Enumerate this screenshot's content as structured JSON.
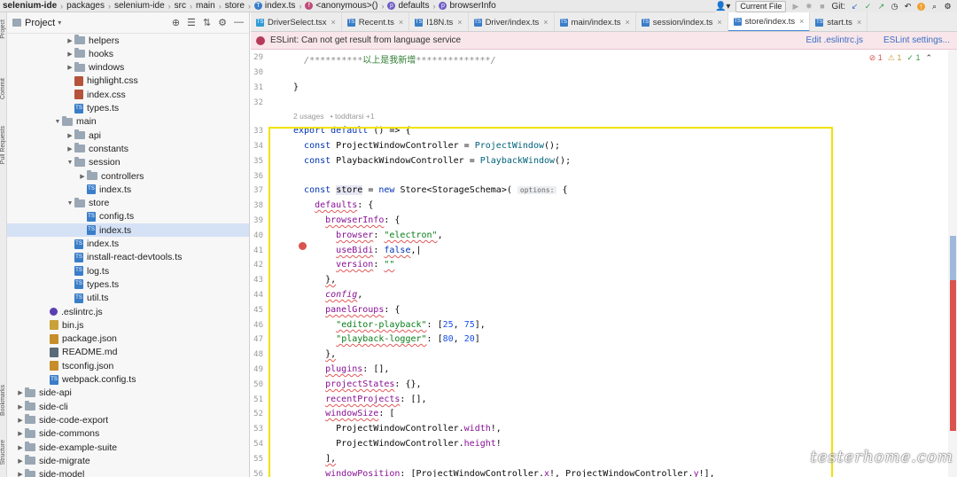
{
  "breadcrumbs": [
    {
      "label": "selenium-ide",
      "icon": "",
      "bold": true
    },
    {
      "label": "packages",
      "icon": ""
    },
    {
      "label": "selenium-ide",
      "icon": ""
    },
    {
      "label": "src",
      "icon": ""
    },
    {
      "label": "main",
      "icon": ""
    },
    {
      "label": "store",
      "icon": ""
    },
    {
      "label": "index.ts",
      "icon": "ts-file-icon"
    },
    {
      "label": "<anonymous>()",
      "icon": "function-icon"
    },
    {
      "label": "defaults",
      "icon": "property-icon"
    },
    {
      "label": "browserInfo",
      "icon": "property-icon"
    }
  ],
  "toolbar": {
    "run_config": "Current File",
    "git_label": "Git:"
  },
  "side_stripe": {
    "project": "Project",
    "commit": "Commit",
    "pull_requests": "Pull Requests",
    "bookmarks": "Bookmarks",
    "structure": "Structure"
  },
  "project_panel": {
    "title": "Project"
  },
  "tree": [
    {
      "label": "helpers",
      "type": "folder",
      "depth": 5,
      "arrow": "▶"
    },
    {
      "label": "hooks",
      "type": "folder",
      "depth": 5,
      "arrow": "▶"
    },
    {
      "label": "windows",
      "type": "folder",
      "depth": 5,
      "arrow": "▶"
    },
    {
      "label": "highlight.css",
      "type": "css",
      "depth": 5,
      "arrow": ""
    },
    {
      "label": "index.css",
      "type": "css",
      "depth": 5,
      "arrow": ""
    },
    {
      "label": "types.ts",
      "type": "ts",
      "depth": 5,
      "arrow": ""
    },
    {
      "label": "main",
      "type": "folder",
      "depth": 4,
      "arrow": "▼"
    },
    {
      "label": "api",
      "type": "folder",
      "depth": 5,
      "arrow": "▶"
    },
    {
      "label": "constants",
      "type": "folder",
      "depth": 5,
      "arrow": "▶"
    },
    {
      "label": "session",
      "type": "folder",
      "depth": 5,
      "arrow": "▼"
    },
    {
      "label": "controllers",
      "type": "folder",
      "depth": 6,
      "arrow": "▶"
    },
    {
      "label": "index.ts",
      "type": "ts",
      "depth": 6,
      "arrow": ""
    },
    {
      "label": "store",
      "type": "folder",
      "depth": 5,
      "arrow": "▼"
    },
    {
      "label": "config.ts",
      "type": "ts",
      "depth": 6,
      "arrow": ""
    },
    {
      "label": "index.ts",
      "type": "ts",
      "depth": 6,
      "arrow": "",
      "selected": true
    },
    {
      "label": "index.ts",
      "type": "ts",
      "depth": 5,
      "arrow": ""
    },
    {
      "label": "install-react-devtools.ts",
      "type": "ts",
      "depth": 5,
      "arrow": ""
    },
    {
      "label": "log.ts",
      "type": "ts",
      "depth": 5,
      "arrow": ""
    },
    {
      "label": "types.ts",
      "type": "ts",
      "depth": 5,
      "arrow": ""
    },
    {
      "label": "util.ts",
      "type": "ts",
      "depth": 5,
      "arrow": ""
    },
    {
      "label": ".eslintrc.js",
      "type": "es",
      "depth": 3,
      "arrow": ""
    },
    {
      "label": "bin.js",
      "type": "js",
      "depth": 3,
      "arrow": ""
    },
    {
      "label": "package.json",
      "type": "json",
      "depth": 3,
      "arrow": ""
    },
    {
      "label": "README.md",
      "type": "md",
      "depth": 3,
      "arrow": ""
    },
    {
      "label": "tsconfig.json",
      "type": "json",
      "depth": 3,
      "arrow": ""
    },
    {
      "label": "webpack.config.ts",
      "type": "ts",
      "depth": 3,
      "arrow": ""
    },
    {
      "label": "side-api",
      "type": "folder",
      "depth": 1,
      "arrow": "▶"
    },
    {
      "label": "side-cli",
      "type": "folder",
      "depth": 1,
      "arrow": "▶"
    },
    {
      "label": "side-code-export",
      "type": "folder",
      "depth": 1,
      "arrow": "▶"
    },
    {
      "label": "side-commons",
      "type": "folder",
      "depth": 1,
      "arrow": "▶"
    },
    {
      "label": "side-example-suite",
      "type": "folder",
      "depth": 1,
      "arrow": "▶"
    },
    {
      "label": "side-migrate",
      "type": "folder",
      "depth": 1,
      "arrow": "▶"
    },
    {
      "label": "side-model",
      "type": "folder",
      "depth": 1,
      "arrow": "▶"
    }
  ],
  "tabs": [
    {
      "label": "DriverSelect.tsx",
      "icon": "tsx"
    },
    {
      "label": "Recent.ts",
      "icon": "ts"
    },
    {
      "label": "I18N.ts",
      "icon": "ts"
    },
    {
      "label": "Driver/index.ts",
      "icon": "ts"
    },
    {
      "label": "main/index.ts",
      "icon": "ts"
    },
    {
      "label": "session/index.ts",
      "icon": "ts"
    },
    {
      "label": "store/index.ts",
      "icon": "ts",
      "active": true
    },
    {
      "label": "start.ts",
      "icon": "ts"
    }
  ],
  "eslint_banner": {
    "message": "ESLint: Can not get result from language service",
    "edit_link": "Edit .eslintrc.js",
    "settings_link": "ESLint settings..."
  },
  "inspections": {
    "errors": "1",
    "warnings": "1",
    "ok": "1"
  },
  "code_meta": {
    "usages": "2 usages",
    "author": "toddtarsi +1"
  },
  "code_lines": [
    {
      "n": "29",
      "html": "  <span class=\"cm\">/**********</span><span class=\"cmg\">以上是我新增</span><span class=\"cm\">**************/</span>"
    },
    {
      "n": "30",
      "html": ""
    },
    {
      "n": "31",
      "html": "}"
    },
    {
      "n": "32",
      "html": ""
    },
    {
      "n": "33",
      "html": "<span class=\"kw\">export default</span> () => {"
    },
    {
      "n": "34",
      "html": "  <span class=\"kw\">const</span> ProjectWindowController = <span class=\"fn\">ProjectWindow</span>();"
    },
    {
      "n": "35",
      "html": "  <span class=\"kw\">const</span> PlaybackWindowController = <span class=\"fn\">PlaybackWindow</span>();"
    },
    {
      "n": "36",
      "html": ""
    },
    {
      "n": "37",
      "html": "  <span class=\"kw\">const</span> <span class=\"hlvar\">store</span> = <span class=\"kw\">new</span> Store&lt;StorageSchema&gt;( <span class=\"hint\">options:</span> {"
    },
    {
      "n": "38",
      "html": "    <span class=\"prop wavy\">defaults</span>: {"
    },
    {
      "n": "39",
      "html": "      <span class=\"prop wavy\">browserInfo</span>: {"
    },
    {
      "n": "40",
      "html": "        <span class=\"prop wavy\">browser</span>: <span class=\"str wavy\">\"electron\"</span>,"
    },
    {
      "n": "41",
      "html": "        <span class=\"prop wavy\">useBidi</span>: <span class=\"kw wavy\">false</span>,|"
    },
    {
      "n": "42",
      "html": "        <span class=\"prop wavy\">version</span>: <span class=\"str wavy\">\"\"</span>"
    },
    {
      "n": "43",
      "html": "      <span class=\"wavy\">},</span>"
    },
    {
      "n": "44",
      "html": "      <span class=\"prop wavy\"><i>config</i></span>,"
    },
    {
      "n": "45",
      "html": "      <span class=\"prop wavy\">panelGroups</span>: {"
    },
    {
      "n": "46",
      "html": "        <span class=\"str wavy\">\"editor-playback\"</span>: [<span class=\"num\">25</span>, <span class=\"num\">75</span>],"
    },
    {
      "n": "47",
      "html": "        <span class=\"str wavy\">\"playback-logger\"</span>: [<span class=\"num\">80</span>, <span class=\"num\">20</span>]"
    },
    {
      "n": "48",
      "html": "      <span class=\"wavy\">},</span>"
    },
    {
      "n": "49",
      "html": "      <span class=\"prop wavy\">plugins</span>: [],"
    },
    {
      "n": "50",
      "html": "      <span class=\"prop wavy\">projectStates</span>: {},"
    },
    {
      "n": "51",
      "html": "      <span class=\"prop wavy\">recentProjects</span>: [],"
    },
    {
      "n": "52",
      "html": "      <span class=\"prop wavy\">windowSize</span>: ["
    },
    {
      "n": "53",
      "html": "        ProjectWindowController.<span class=\"prop\">width</span>!,"
    },
    {
      "n": "54",
      "html": "        ProjectWindowController.<span class=\"prop\">height</span>!"
    },
    {
      "n": "55",
      "html": "      <span class=\"wavy\">],</span>"
    },
    {
      "n": "56",
      "html": "      <span class=\"prop wavy\">windowPosition</span>: [ProjectWindowController.<span class=\"prop\">x</span>!, ProjectWindowController.<span class=\"prop\">y</span>!],"
    }
  ],
  "watermark": "testerhome.com",
  "colors": {
    "highlight_box": "#f2e200",
    "keyword": "#0033b3",
    "string": "#067d17",
    "property": "#871094"
  }
}
